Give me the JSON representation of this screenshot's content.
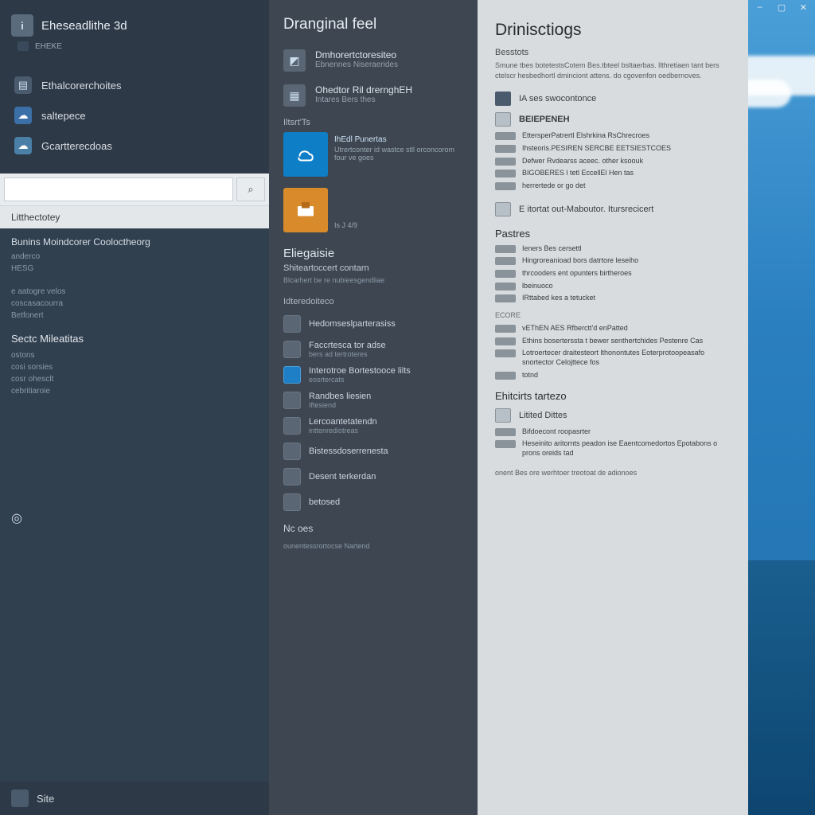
{
  "titlebar": {
    "min": "–",
    "max": "▢",
    "close": "✕"
  },
  "sidebar": {
    "header": {
      "title": "Eheseadlithe 3d",
      "sub": "EHEKE"
    },
    "nav": [
      {
        "label": "Ethalcorerchoites"
      },
      {
        "label": "saltepece"
      },
      {
        "label": "Gcartterecdoas"
      }
    ],
    "search": {
      "placeholder": ""
    },
    "tab": "Litthectotey",
    "body": {
      "top": {
        "title": "Bunins Moindcorer Cooloctheorg",
        "lines": [
          "anderco",
          "HESG"
        ]
      },
      "grp2": {
        "lines": [
          "e aatogre velos",
          "coscasacourra",
          "Betfonert"
        ]
      },
      "sec1": {
        "title": "Sectc Mileatitas",
        "lines": [
          "ostons",
          "cosi sorsies",
          "cosr ohesclt",
          "cebritiaroie"
        ]
      }
    },
    "bottomIcon": "◎",
    "footer": "Site"
  },
  "middle": {
    "title": "Dranginal feel",
    "items": [
      {
        "title": "Dmhorertctoresiteo",
        "sub": "Ebnennes Niseraerides"
      },
      {
        "title": "Ohedtor Ril drernghEH",
        "sub": "Intares Bers thes"
      }
    ],
    "sh": "Iltsrt'Ts",
    "tile1": {
      "t": "IhEdl   Punertas",
      "s": "Utrertconter id wastce stll orconcorom four ve goes"
    },
    "tile2": {
      "pg": "Is J 4/9"
    },
    "sec2": {
      "title": "Eliegaisie",
      "sub": "Shiteartoccert contarn",
      "line": "Blcarhert be re nubieesgendliae"
    },
    "sh2": "Idteredoiteco",
    "list": [
      {
        "t": "Hedomseslparterasiss"
      },
      {
        "t": "Faccrtesca tor adse",
        "s": "bers ad tertroteres"
      },
      {
        "t": "Interotroe Bortestooce lilts",
        "s": "eosrtercats"
      },
      {
        "t": "Randbes liesien",
        "s": "Iftesiend"
      },
      {
        "t": "Lercoantetatendn",
        "s": "inttenrediotreas"
      },
      {
        "t": "Bistessdoserrenesta"
      },
      {
        "t": "Desent terkerdan"
      },
      {
        "t": "betosed"
      }
    ],
    "ft": "Nc  oes",
    "last": "ounentessrortocse Nartend"
  },
  "right": {
    "title": "Drinisctiogs",
    "sub": "Besstots",
    "desc": "Smune tbes botetestsCotem Bes.tbteel bsltaerbas. llthretiaen tant bers ctelscr hesbedhortl dminciont attens. do cgovenfon oedbernoves.",
    "row1": "IA ses swocontonce",
    "sec1": "BEIEPENEH",
    "lines1": [
      "EttersperPatrertl Elshrkina RsChrecroes",
      "Ihsteoris.PESIREN SERCBE EETSIESTCOES",
      "Defwer Rvdearss  aceec. other ksoouk",
      "BIGOBERES l tetl EccellEl Hen tas",
      "herrertede or go det"
    ],
    "row2": "E itortat out-Maboutor. Itursrecicert",
    "sec2": "Pastres",
    "lines2": [
      "Ieners Bes cersettl",
      "Hingroreanioad bors datrtore leseiho",
      "thrcooders ent opunters birtheroes",
      "lbeinuoco",
      "IRttabed kes a tetucket"
    ],
    "sh3": "ECORE",
    "lines3": [
      "vEThEN AES Rfberctt'd enPatted",
      "Ethins boserterssta t bewer senthertchides Pestenre Cas",
      "Lotroertecer draitesteort lthonontutes Eoterprotoopeasafo snortector Celojttece fos",
      "totnd"
    ],
    "sec3": "Ehitcirts tartezo",
    "row3": "Litited Dittes",
    "lines4": [
      "Bifdoecont roopasrter",
      "Heseinito aritornts peadon ise Eaentcomedortos Epotabons o prons oreids tad"
    ],
    "foot": "onent Bes ore werhtoer treotoat de adionoes"
  }
}
